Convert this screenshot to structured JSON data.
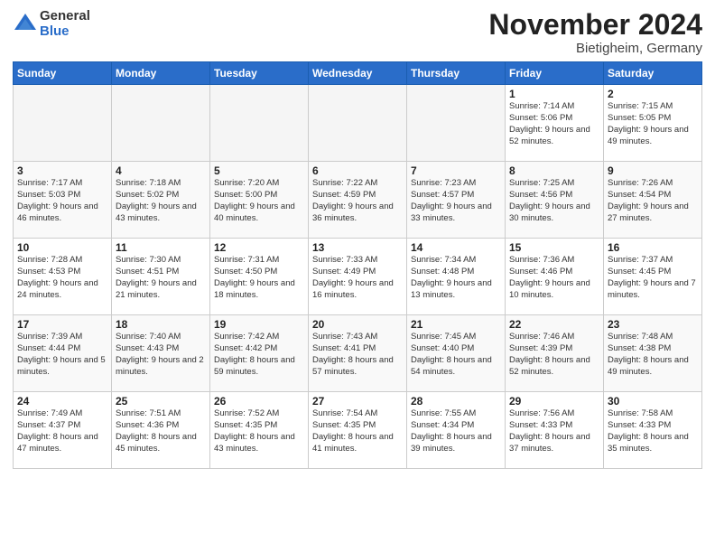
{
  "logo": {
    "general": "General",
    "blue": "Blue"
  },
  "title": "November 2024",
  "subtitle": "Bietigheim, Germany",
  "days_of_week": [
    "Sunday",
    "Monday",
    "Tuesday",
    "Wednesday",
    "Thursday",
    "Friday",
    "Saturday"
  ],
  "weeks": [
    [
      {
        "day": "",
        "empty": true
      },
      {
        "day": "",
        "empty": true
      },
      {
        "day": "",
        "empty": true
      },
      {
        "day": "",
        "empty": true
      },
      {
        "day": "",
        "empty": true
      },
      {
        "day": "1",
        "sunrise": "Sunrise: 7:14 AM",
        "sunset": "Sunset: 5:06 PM",
        "daylight": "Daylight: 9 hours and 52 minutes."
      },
      {
        "day": "2",
        "sunrise": "Sunrise: 7:15 AM",
        "sunset": "Sunset: 5:05 PM",
        "daylight": "Daylight: 9 hours and 49 minutes."
      }
    ],
    [
      {
        "day": "3",
        "sunrise": "Sunrise: 7:17 AM",
        "sunset": "Sunset: 5:03 PM",
        "daylight": "Daylight: 9 hours and 46 minutes."
      },
      {
        "day": "4",
        "sunrise": "Sunrise: 7:18 AM",
        "sunset": "Sunset: 5:02 PM",
        "daylight": "Daylight: 9 hours and 43 minutes."
      },
      {
        "day": "5",
        "sunrise": "Sunrise: 7:20 AM",
        "sunset": "Sunset: 5:00 PM",
        "daylight": "Daylight: 9 hours and 40 minutes."
      },
      {
        "day": "6",
        "sunrise": "Sunrise: 7:22 AM",
        "sunset": "Sunset: 4:59 PM",
        "daylight": "Daylight: 9 hours and 36 minutes."
      },
      {
        "day": "7",
        "sunrise": "Sunrise: 7:23 AM",
        "sunset": "Sunset: 4:57 PM",
        "daylight": "Daylight: 9 hours and 33 minutes."
      },
      {
        "day": "8",
        "sunrise": "Sunrise: 7:25 AM",
        "sunset": "Sunset: 4:56 PM",
        "daylight": "Daylight: 9 hours and 30 minutes."
      },
      {
        "day": "9",
        "sunrise": "Sunrise: 7:26 AM",
        "sunset": "Sunset: 4:54 PM",
        "daylight": "Daylight: 9 hours and 27 minutes."
      }
    ],
    [
      {
        "day": "10",
        "sunrise": "Sunrise: 7:28 AM",
        "sunset": "Sunset: 4:53 PM",
        "daylight": "Daylight: 9 hours and 24 minutes."
      },
      {
        "day": "11",
        "sunrise": "Sunrise: 7:30 AM",
        "sunset": "Sunset: 4:51 PM",
        "daylight": "Daylight: 9 hours and 21 minutes."
      },
      {
        "day": "12",
        "sunrise": "Sunrise: 7:31 AM",
        "sunset": "Sunset: 4:50 PM",
        "daylight": "Daylight: 9 hours and 18 minutes."
      },
      {
        "day": "13",
        "sunrise": "Sunrise: 7:33 AM",
        "sunset": "Sunset: 4:49 PM",
        "daylight": "Daylight: 9 hours and 16 minutes."
      },
      {
        "day": "14",
        "sunrise": "Sunrise: 7:34 AM",
        "sunset": "Sunset: 4:48 PM",
        "daylight": "Daylight: 9 hours and 13 minutes."
      },
      {
        "day": "15",
        "sunrise": "Sunrise: 7:36 AM",
        "sunset": "Sunset: 4:46 PM",
        "daylight": "Daylight: 9 hours and 10 minutes."
      },
      {
        "day": "16",
        "sunrise": "Sunrise: 7:37 AM",
        "sunset": "Sunset: 4:45 PM",
        "daylight": "Daylight: 9 hours and 7 minutes."
      }
    ],
    [
      {
        "day": "17",
        "sunrise": "Sunrise: 7:39 AM",
        "sunset": "Sunset: 4:44 PM",
        "daylight": "Daylight: 9 hours and 5 minutes."
      },
      {
        "day": "18",
        "sunrise": "Sunrise: 7:40 AM",
        "sunset": "Sunset: 4:43 PM",
        "daylight": "Daylight: 9 hours and 2 minutes."
      },
      {
        "day": "19",
        "sunrise": "Sunrise: 7:42 AM",
        "sunset": "Sunset: 4:42 PM",
        "daylight": "Daylight: 8 hours and 59 minutes."
      },
      {
        "day": "20",
        "sunrise": "Sunrise: 7:43 AM",
        "sunset": "Sunset: 4:41 PM",
        "daylight": "Daylight: 8 hours and 57 minutes."
      },
      {
        "day": "21",
        "sunrise": "Sunrise: 7:45 AM",
        "sunset": "Sunset: 4:40 PM",
        "daylight": "Daylight: 8 hours and 54 minutes."
      },
      {
        "day": "22",
        "sunrise": "Sunrise: 7:46 AM",
        "sunset": "Sunset: 4:39 PM",
        "daylight": "Daylight: 8 hours and 52 minutes."
      },
      {
        "day": "23",
        "sunrise": "Sunrise: 7:48 AM",
        "sunset": "Sunset: 4:38 PM",
        "daylight": "Daylight: 8 hours and 49 minutes."
      }
    ],
    [
      {
        "day": "24",
        "sunrise": "Sunrise: 7:49 AM",
        "sunset": "Sunset: 4:37 PM",
        "daylight": "Daylight: 8 hours and 47 minutes."
      },
      {
        "day": "25",
        "sunrise": "Sunrise: 7:51 AM",
        "sunset": "Sunset: 4:36 PM",
        "daylight": "Daylight: 8 hours and 45 minutes."
      },
      {
        "day": "26",
        "sunrise": "Sunrise: 7:52 AM",
        "sunset": "Sunset: 4:35 PM",
        "daylight": "Daylight: 8 hours and 43 minutes."
      },
      {
        "day": "27",
        "sunrise": "Sunrise: 7:54 AM",
        "sunset": "Sunset: 4:35 PM",
        "daylight": "Daylight: 8 hours and 41 minutes."
      },
      {
        "day": "28",
        "sunrise": "Sunrise: 7:55 AM",
        "sunset": "Sunset: 4:34 PM",
        "daylight": "Daylight: 8 hours and 39 minutes."
      },
      {
        "day": "29",
        "sunrise": "Sunrise: 7:56 AM",
        "sunset": "Sunset: 4:33 PM",
        "daylight": "Daylight: 8 hours and 37 minutes."
      },
      {
        "day": "30",
        "sunrise": "Sunrise: 7:58 AM",
        "sunset": "Sunset: 4:33 PM",
        "daylight": "Daylight: 8 hours and 35 minutes."
      }
    ]
  ]
}
